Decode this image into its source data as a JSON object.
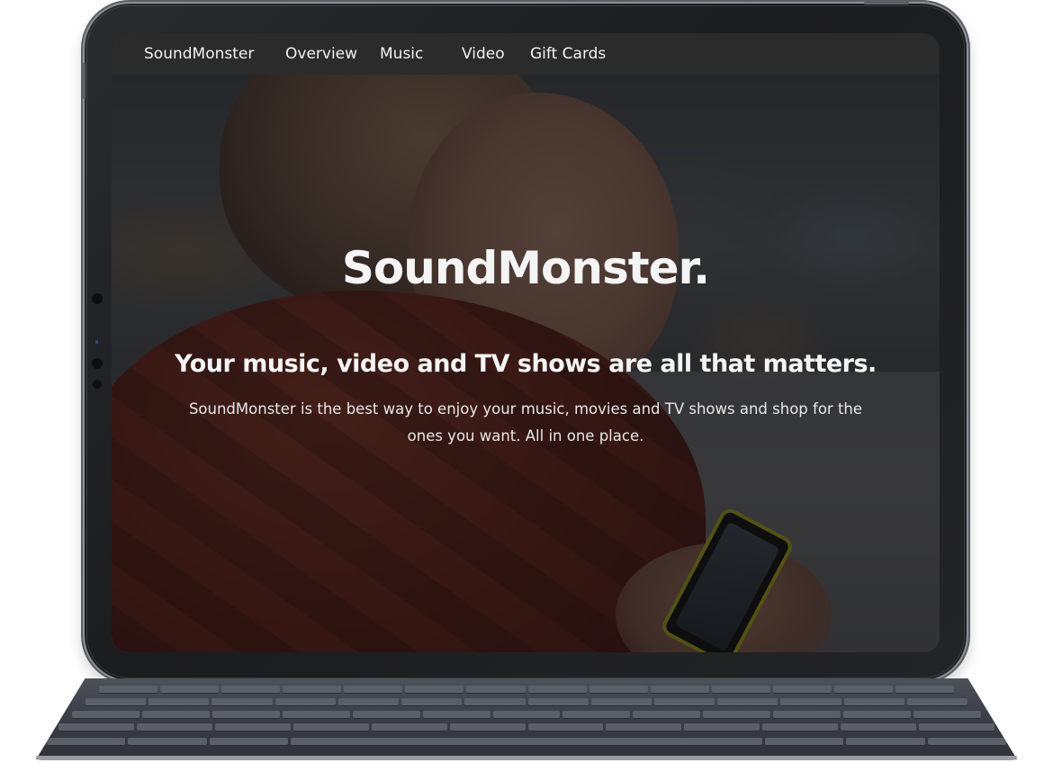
{
  "nav": {
    "brand": "SoundMonster",
    "items": [
      {
        "label": "Overview"
      },
      {
        "label": "Music"
      },
      {
        "label": "Video"
      },
      {
        "label": "Gift Cards"
      }
    ]
  },
  "hero": {
    "title": "SoundMonster.",
    "subtitle": "Your music, video and TV shows are all that matters.",
    "description": "SoundMonster is the best way to enjoy your music, movies and TV shows and shop for the ones you want. All in one place."
  },
  "colors": {
    "navbar_bg": "#2b2b2b",
    "text": "#f4f4f4",
    "hoodie": "#7e2d21",
    "phone_case": "#c9c629"
  }
}
